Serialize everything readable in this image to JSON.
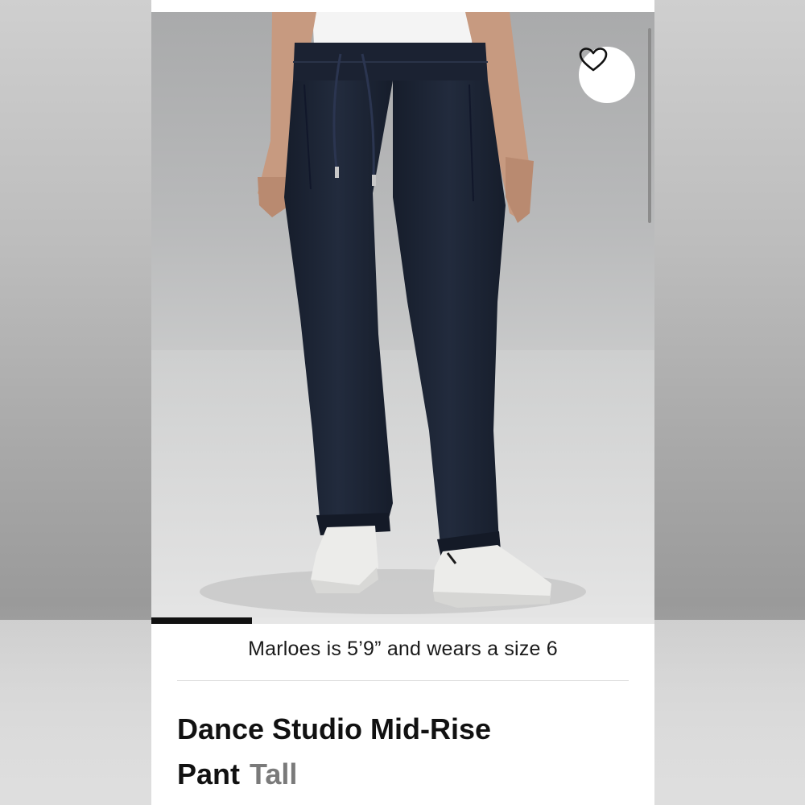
{
  "product": {
    "caption": "Marloes is 5’9” and wears a size 6",
    "title_line1": "Dance Studio Mid-Rise",
    "title_line2": "Pant",
    "variant": "Tall"
  },
  "gallery": {
    "active_index": 1,
    "total": 5
  },
  "icons": {
    "favorite": "heart-outline-icon"
  },
  "colors": {
    "pant": "#1d2535",
    "indicator": "#111111",
    "variant_text": "#7a7a7a"
  }
}
